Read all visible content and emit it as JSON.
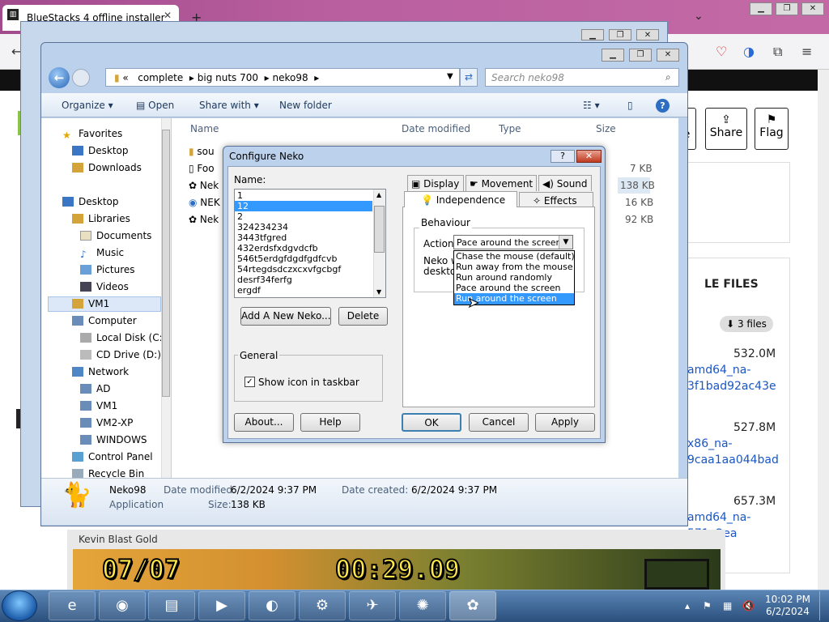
{
  "browser": {
    "tab_title": "BlueStacks 4 offline installer",
    "tab_close": "✕",
    "new_tab": "+",
    "buttons": {
      "share": "Share",
      "flag": "Flag",
      "partial": "e"
    },
    "files_heading": "LE FILES",
    "files_badge": "3 files",
    "files": [
      {
        "size": "532.0M",
        "line1": "amd64_na-",
        "line2": "3f1bad92ac43e"
      },
      {
        "size": "527.8M",
        "line1": "x86_na-",
        "line2": "9caa1aa044bad"
      },
      {
        "size": "657.3M",
        "line1": "amd64_na-",
        "line2": "571a2ea"
      }
    ]
  },
  "explorer": {
    "path": [
      "«",
      "complete",
      "big nuts 700",
      "neko98"
    ],
    "search_placeholder": "Search neko98",
    "toolbar": {
      "organize": "Organize ▾",
      "open": "Open",
      "share_with": "Share with ▾",
      "new_folder": "New folder"
    },
    "nav": {
      "favorites": "Favorites",
      "desktop": "Desktop",
      "downloads": "Downloads",
      "desktop2": "Desktop",
      "libraries": "Libraries",
      "documents": "Documents",
      "music": "Music",
      "pictures": "Pictures",
      "videos": "Videos",
      "vm1": "VM1",
      "computer": "Computer",
      "local_disk": "Local Disk (C:)",
      "cd_drive": "CD Drive (D:)",
      "network": "Network",
      "ad": "AD",
      "vm1b": "VM1",
      "vm2xp": "VM2-XP",
      "windows": "WINDOWS",
      "control_panel": "Control Panel",
      "recycle_bin": "Recycle Bin"
    },
    "columns": {
      "name": "Name",
      "date": "Date modified",
      "type": "Type",
      "size": "Size"
    },
    "files": [
      {
        "name": "sou",
        "size": ""
      },
      {
        "name": "Foo",
        "size": "7 KB"
      },
      {
        "name": "Nek",
        "size": "138 KB"
      },
      {
        "name": "NEK",
        "size": "16 KB"
      },
      {
        "name": "Nek",
        "size": "92 KB"
      }
    ],
    "details": {
      "name": "Neko98",
      "kind": "Application",
      "date_modified_label": "Date modified:",
      "date_modified": "6/2/2024 9:37 PM",
      "date_created_label": "Date created:",
      "date_created": "6/2/2024 9:37 PM",
      "size_label": "Size:",
      "size": "138 KB"
    }
  },
  "dialog": {
    "title": "Configure Neko",
    "help_btn": "?",
    "close_btn": "✕",
    "name_label": "Name:",
    "names": [
      "1",
      "12",
      "2",
      "324234234",
      "3443tfgred",
      "432erdsfxdgvdcfb",
      "546t5erdgfdgdfgdfcvb",
      "54rtegdsdczxcxvfgcbgf",
      "desrf34ferfg",
      "ergdf"
    ],
    "add_btn": "Add A New Neko...",
    "delete_btn": "Delete",
    "general_label": "General",
    "show_icon": "Show icon in taskbar",
    "about_btn": "About...",
    "help2_btn": "Help",
    "ok_btn": "OK",
    "cancel_btn": "Cancel",
    "apply_btn": "Apply",
    "tabs": {
      "display": "Display",
      "movement": "Movement",
      "sound": "Sound",
      "independence": "Independence",
      "effects": "Effects"
    },
    "behaviour_label": "Behaviour",
    "action_label": "Action:",
    "action_value": "Pace around the screen",
    "desc_partial1": "Neko w",
    "desc_partial2": "desktop",
    "options": [
      "Chase the mouse (default)",
      "Run away from the mouse",
      "Run around randomly",
      "Pace around the screen",
      "Run around the screen"
    ]
  },
  "video": {
    "title": "Kevin Blast Gold",
    "score": "07/07",
    "timer": "00:29.09"
  },
  "taskbar": {
    "time": "10:02 PM",
    "date": "6/2/2024"
  }
}
